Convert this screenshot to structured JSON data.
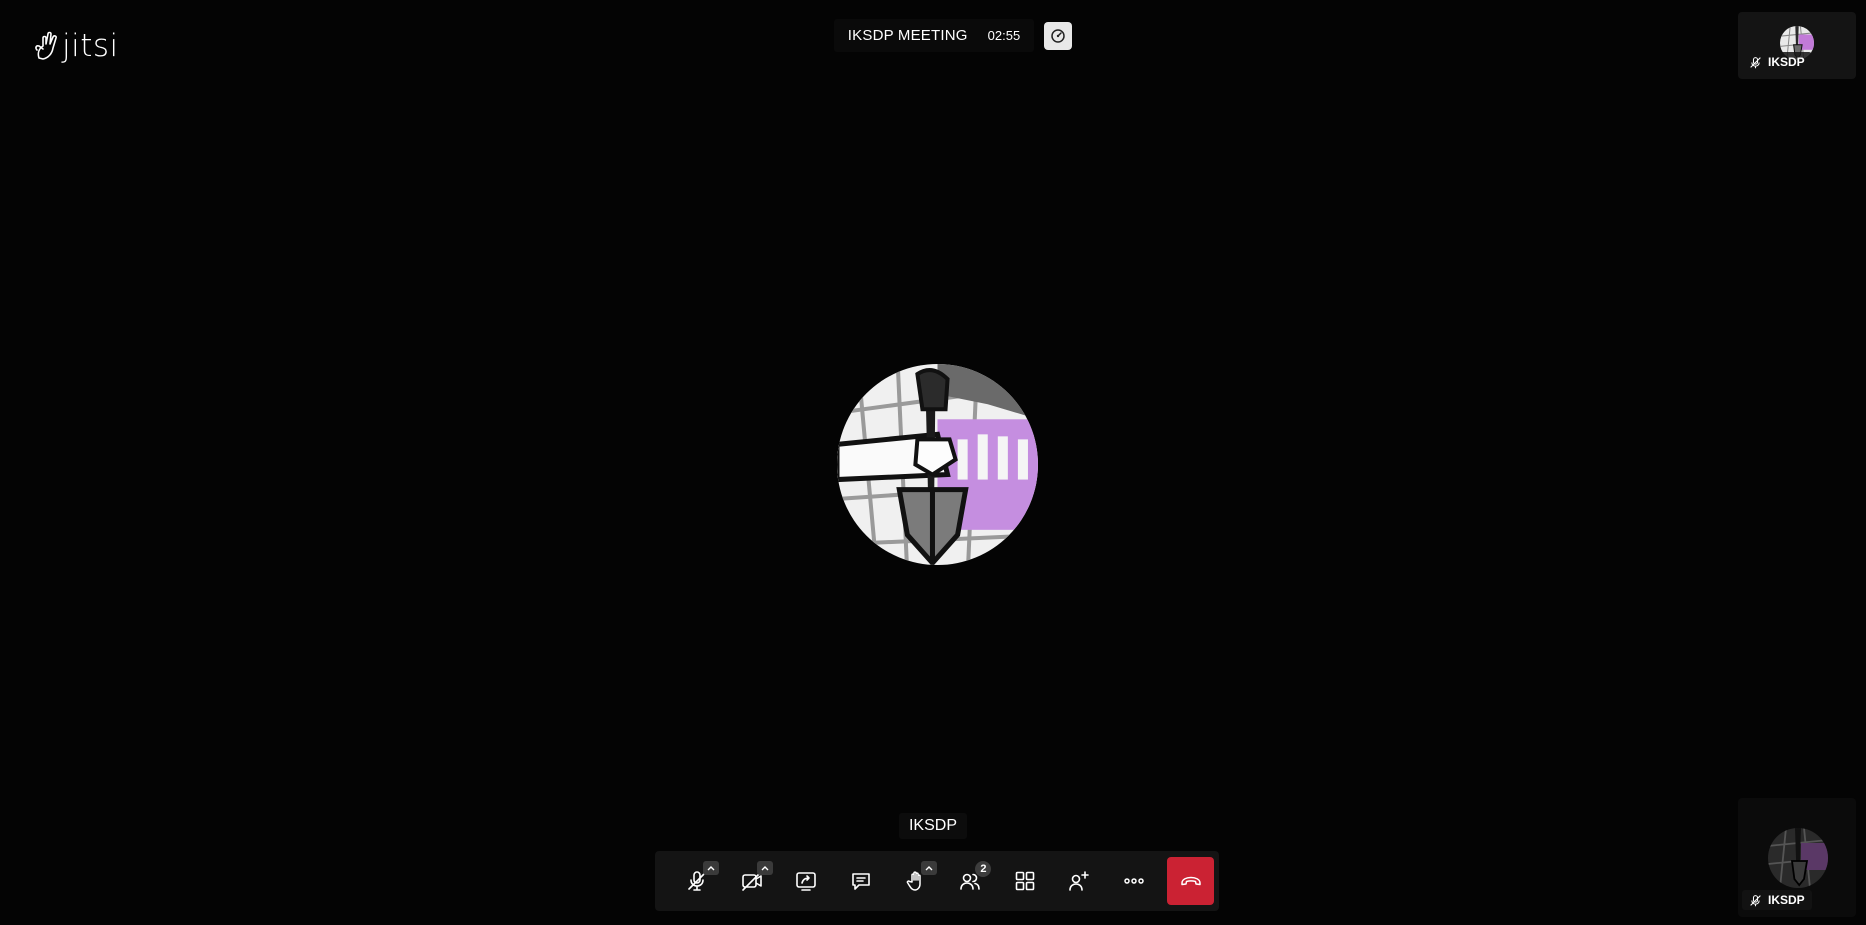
{
  "app": {
    "logo_text": "jitsi"
  },
  "header": {
    "subject": "IKSDP MEETING",
    "timer": "02:55"
  },
  "main": {
    "display_name": "IKSDP"
  },
  "thumbnails": [
    {
      "name": "IKSDP",
      "muted": true
    },
    {
      "name": "IKSDP",
      "muted": true
    }
  ],
  "toolbar": {
    "buttons": [
      {
        "id": "microphone",
        "icon": "mic-off-icon",
        "has_menu": true
      },
      {
        "id": "camera",
        "icon": "camera-off-icon",
        "has_menu": true
      },
      {
        "id": "share-screen",
        "icon": "share-screen-icon"
      },
      {
        "id": "chat",
        "icon": "chat-icon"
      },
      {
        "id": "raise-hand",
        "icon": "hand-icon",
        "has_menu": true
      },
      {
        "id": "participants",
        "icon": "participants-icon",
        "badge": "2"
      },
      {
        "id": "tile-view",
        "icon": "tile-view-icon"
      },
      {
        "id": "invite",
        "icon": "add-person-icon"
      },
      {
        "id": "more",
        "icon": "more-icon"
      },
      {
        "id": "hangup",
        "icon": "hangup-icon"
      }
    ],
    "participant_count": "2"
  },
  "colors": {
    "background": "#040404",
    "toolbar": "#141414",
    "hangup": "#cb2233"
  }
}
